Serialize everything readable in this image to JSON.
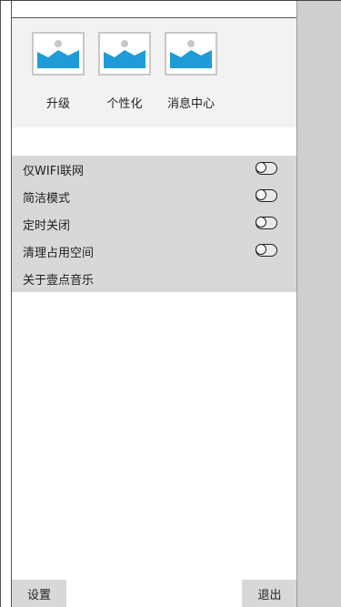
{
  "menu_tiles": [
    {
      "label": "升级",
      "icon": "image-placeholder-icon"
    },
    {
      "label": "个性化",
      "icon": "image-placeholder-icon"
    },
    {
      "label": "消息中心",
      "icon": "image-placeholder-icon"
    }
  ],
  "settings": [
    {
      "label": "仅WIFI联网",
      "toggle": "off"
    },
    {
      "label": "简洁模式",
      "toggle": "off"
    },
    {
      "label": "定时关闭",
      "toggle": "off"
    },
    {
      "label": "清理占用空间",
      "toggle": "off"
    },
    {
      "label": "关于壹点音乐"
    }
  ],
  "footer": {
    "settings_label": "设置",
    "logout_label": "退出"
  },
  "colors": {
    "panel_gray": "#d8d8d8",
    "icon_panel": "#f2f2f2",
    "overlay": "#cfcfcf",
    "icon_blue": "#1f9bd7"
  }
}
